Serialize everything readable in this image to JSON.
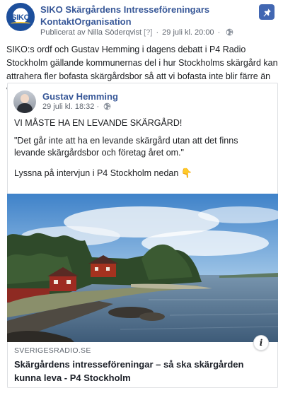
{
  "page": {
    "name": "SIKO Skärgårdens Intresseföreningars KontaktOrganisation",
    "avatar_text": "SIKO"
  },
  "meta": {
    "published_by": "Publicerat av Nilla Söderqvist",
    "tag": "[?]",
    "dot": "·",
    "timestamp": "29 juli kl. 20:00",
    "dot2": "·",
    "privacy_icon": "globe-icon"
  },
  "post": {
    "text": "SIKO:s ordf och Gustav Hemming i dagens debatt i P4 Radio Stockholm gällande kommunernas del i hur Stockholms skärgård kan attrahera fler bofasta skärgårdsbor så att vi bofasta inte blir färre än vi redan är!"
  },
  "shared": {
    "author": "Gustav Hemming",
    "timestamp": "29 juli kl. 18:32",
    "dot": "·",
    "line1": "VI MÅSTE HA EN LEVANDE SKÄRGÅRD!",
    "line2": "\"Det går inte att ha en levande skärgård utan att det finns levande skärgårdsbor och företag året om.\"",
    "line3": "Lyssna på intervjun i P4 Stockholm nedan",
    "line3_emoji": "👇"
  },
  "link": {
    "domain": "SVERIGESRADIO.SE",
    "title": "Skärgårdens intresseföreningar – så ska skärgården kunna leva - P4 Stockholm",
    "info_label": "i"
  },
  "colors": {
    "link_blue": "#385898",
    "pin_blue": "#4267b2"
  }
}
